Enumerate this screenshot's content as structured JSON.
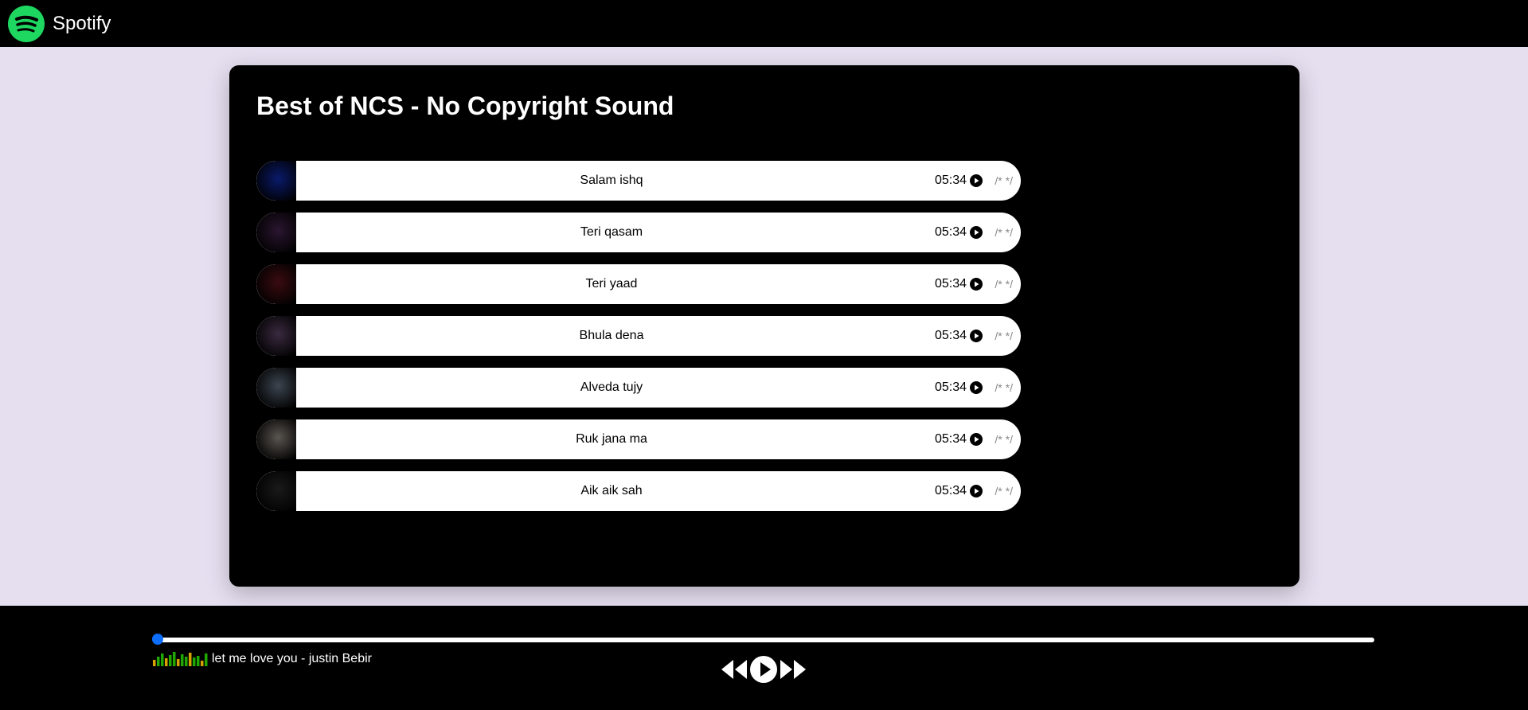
{
  "navbar": {
    "brand": "Spotify",
    "logo_icon": "spotify-logo-icon"
  },
  "playlist": {
    "title": "Best of NCS - No Copyright Sound",
    "songs": [
      {
        "name": "Salam ishq",
        "duration": "05:34",
        "comment": "/* */",
        "cover_color": "#0a1a6a"
      },
      {
        "name": "Teri qasam",
        "duration": "05:34",
        "comment": "/* */",
        "cover_color": "#2a1630"
      },
      {
        "name": "Teri yaad",
        "duration": "05:34",
        "comment": "/* */",
        "cover_color": "#3a0b10"
      },
      {
        "name": "Bhula dena",
        "duration": "05:34",
        "comment": "/* */",
        "cover_color": "#3a2a40"
      },
      {
        "name": "Alveda tujy",
        "duration": "05:34",
        "comment": "/* */",
        "cover_color": "#3c4550"
      },
      {
        "name": "Ruk jana ma",
        "duration": "05:34",
        "comment": "/* */",
        "cover_color": "#5a5550"
      },
      {
        "name": "Aik aik sah",
        "duration": "05:34",
        "comment": "/* */",
        "cover_color": "#1a1a1a"
      }
    ]
  },
  "player": {
    "progress_fraction": 0,
    "now_playing": "let me love you - justin Bebir",
    "accent_color": "#0d6efd",
    "controls": [
      "previous-icon",
      "play-icon",
      "next-icon"
    ]
  },
  "colors": {
    "brand_green": "#1ed760",
    "page_background": "#e6dff0"
  }
}
